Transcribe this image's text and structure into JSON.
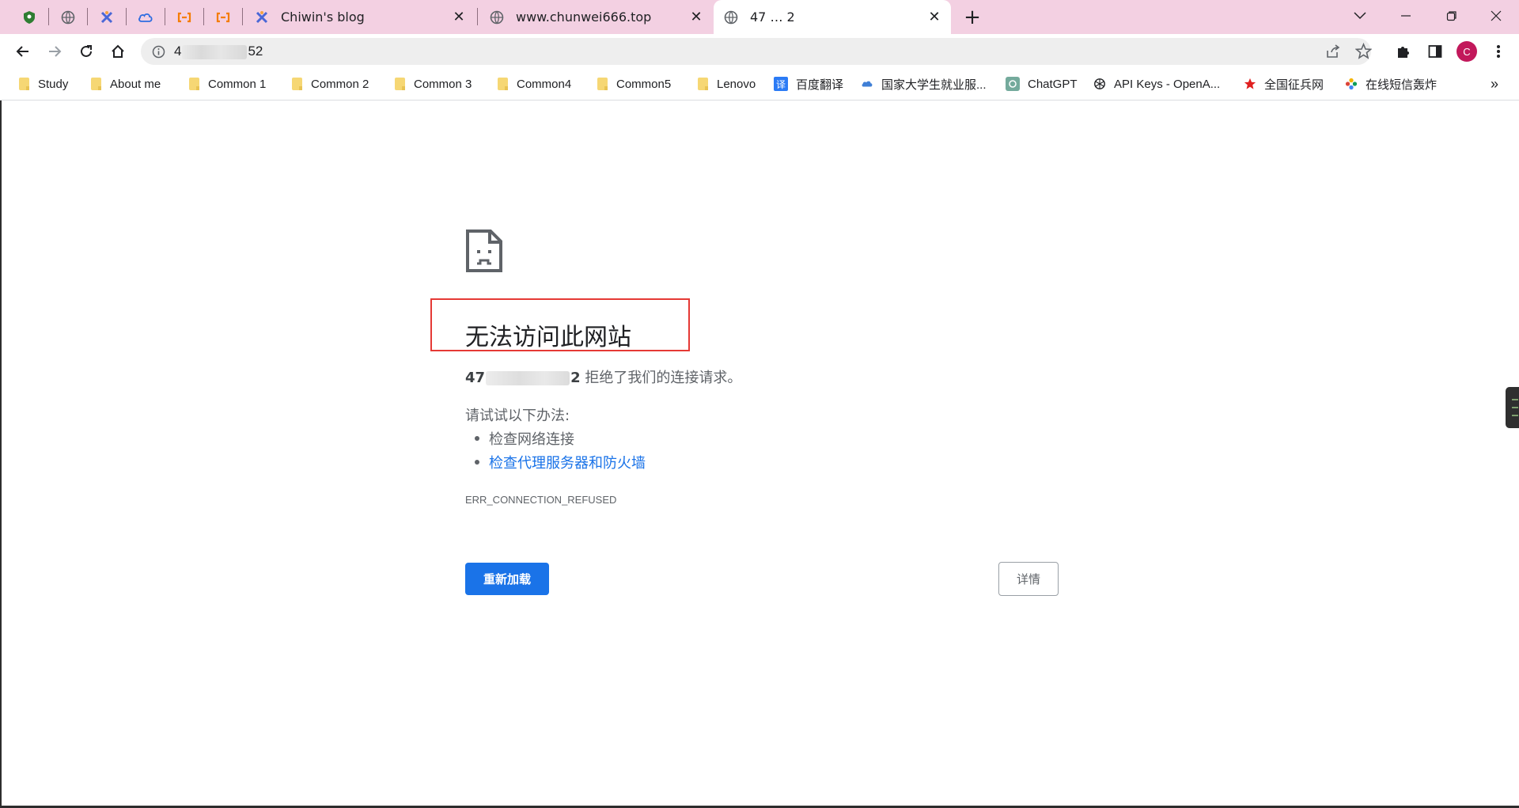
{
  "tabs": {
    "pinned": [
      {
        "icon": "shield-icon",
        "color": "#2e7d32"
      },
      {
        "icon": "globe-icon",
        "color": "#5f6368"
      },
      {
        "icon": "app-logo-icon",
        "color": "#4a67d6"
      },
      {
        "icon": "cloud-icon",
        "color": "#2f6de1"
      },
      {
        "icon": "brackets-icon",
        "color": "#f57c00"
      },
      {
        "icon": "brackets-icon",
        "color": "#f57c00"
      }
    ],
    "items": [
      {
        "title": "Chiwin's blog",
        "icon": "app-logo-icon",
        "active": false
      },
      {
        "title": "www.chunwei666.top",
        "icon": "globe-icon",
        "active": false
      },
      {
        "title": "47 … 2",
        "icon": "globe-icon",
        "active": true
      }
    ],
    "new_tab_label": "+"
  },
  "toolbar": {
    "url_prefix": "4",
    "url_suffix": "52"
  },
  "bookmarks": [
    {
      "label": "Study",
      "icon": "folder-icon"
    },
    {
      "label": "About me",
      "icon": "folder-icon"
    },
    {
      "label": "Common 1",
      "icon": "folder-icon"
    },
    {
      "label": "Common 2",
      "icon": "folder-icon"
    },
    {
      "label": "Common 3",
      "icon": "folder-icon"
    },
    {
      "label": "Common4",
      "icon": "folder-icon"
    },
    {
      "label": "Common5",
      "icon": "folder-icon"
    },
    {
      "label": "Lenovo",
      "icon": "folder-icon"
    },
    {
      "label": "百度翻译",
      "icon": "translate-icon"
    },
    {
      "label": "国家大学生就业服...",
      "icon": "cloud-icon"
    },
    {
      "label": "ChatGPT",
      "icon": "chatgpt-icon"
    },
    {
      "label": "API Keys - OpenA...",
      "icon": "openai-icon"
    },
    {
      "label": "全国征兵网",
      "icon": "star-icon"
    },
    {
      "label": "在线短信轰炸",
      "icon": "flower-icon"
    }
  ],
  "bookmarks_overflow": "»",
  "error_page": {
    "title": "无法访问此网站",
    "host_prefix": "47",
    "host_suffix": "2",
    "message": "拒绝了我们的连接请求。",
    "suggestions_title": "请试试以下办法:",
    "suggestions": [
      "检查网络连接",
      "检查代理服务器和防火墙"
    ],
    "error_code": "ERR_CONNECTION_REFUSED",
    "reload_label": "重新加载",
    "details_label": "详情"
  },
  "colors": {
    "tabstrip_bg": "#f3d0e2",
    "accent_blue": "#1a73e8",
    "highlight_red": "#e53935",
    "profile_avatar": "#c2185b"
  },
  "profile_initial": "C"
}
